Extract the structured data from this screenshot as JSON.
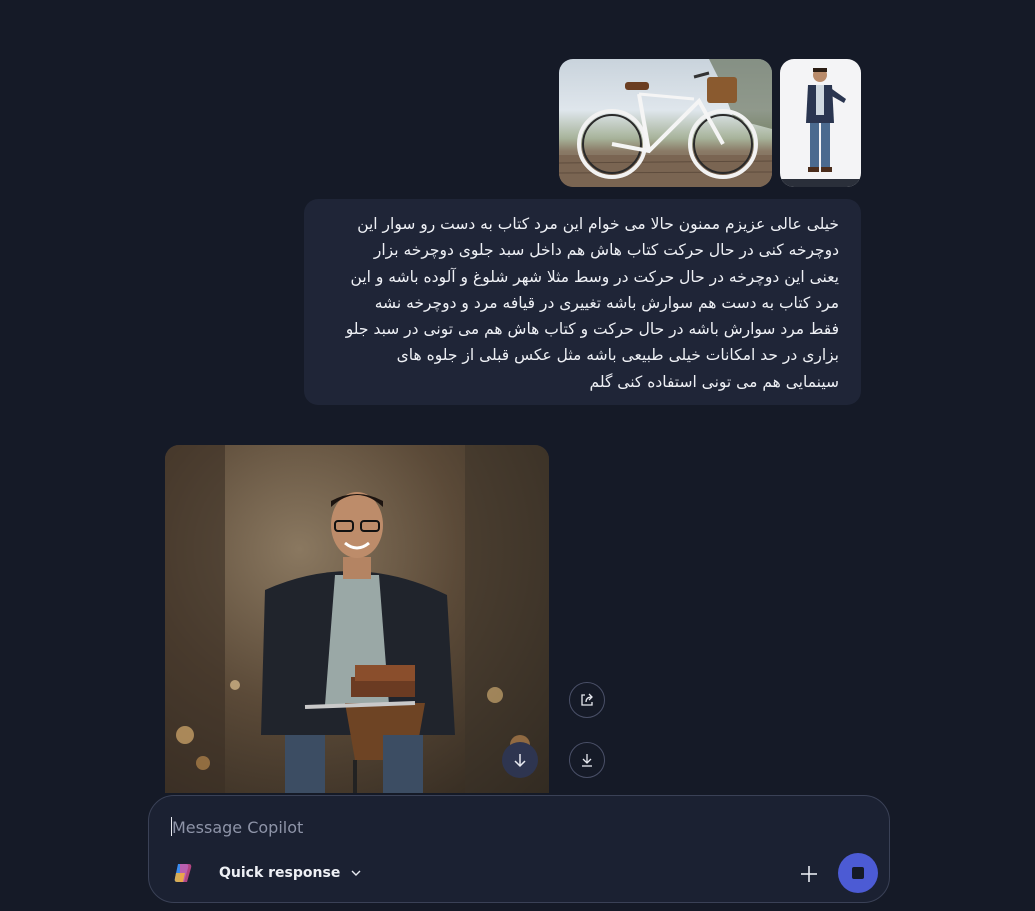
{
  "conversation": {
    "user_message": {
      "attachments": [
        {
          "icon": "bicycle-photo"
        },
        {
          "icon": "man-standing-photo"
        }
      ],
      "lines": [
        "خیلی عالی عزیزم ممنون حالا می خوام این مرد کتاب به دست رو سوار این",
        "دوچرخه کنی در حال حرکت کتاب هاش هم داخل سبد جلوی دوچرخه بزار",
        "یعنی این دوچرخه در حال حرکت در وسط مثلا شهر شلوغ و آلوده باشه و این",
        "مرد کتاب به دست هم سوارش باشه تغییری در قیافه مرد و دوچرخه نشه",
        "فقط مرد سوارش باشه در حال حرکت و کتاب هاش هم می تونی در سبد جلو",
        "بزاری در حد امکانات خیلی طبیعی باشه مثل عکس قبلی از جلوه های",
        "سینمایی هم می تونی استفاده کنی گلم"
      ]
    },
    "assistant_message": {
      "image_icon": "man-riding-bicycle-image",
      "actions": [
        {
          "icon": "share-icon"
        },
        {
          "icon": "download-icon"
        }
      ]
    }
  },
  "composer": {
    "placeholder": "Message Copilot",
    "value": "",
    "mode_label": "Quick response",
    "colors": {
      "accent": "#4c5bd4",
      "background": "#151a27",
      "bubble": "#1f2537"
    }
  }
}
